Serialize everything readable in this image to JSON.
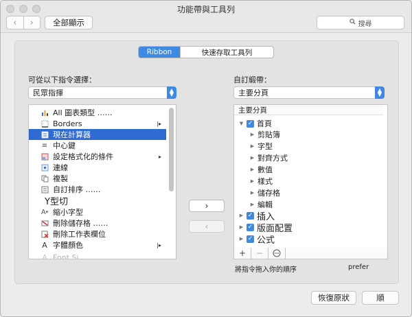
{
  "window": {
    "title": "功能帶與工具列"
  },
  "toolbar": {
    "back_icon": "chevron-left-icon",
    "forward_icon": "chevron-right-icon",
    "show_all": "全部顯示",
    "search_placeholder": "搜尋"
  },
  "tabs": [
    {
      "label": "Ribbon",
      "selected": true
    },
    {
      "label": "快速存取工具列",
      "selected": false
    }
  ],
  "left": {
    "label": "可從以下指令選擇：",
    "dropdown_value": "民眾指揮",
    "commands": [
      {
        "icon": "chart-icon",
        "label": "All 圖表類型 ……",
        "marker": ""
      },
      {
        "icon": "borders-icon",
        "label": "Borders",
        "marker": "|▸"
      },
      {
        "icon": "calculator-icon",
        "label": "現在計算器",
        "marker": "",
        "selected": true
      },
      {
        "icon": "center-icon",
        "label": "中心鍵",
        "marker": ""
      },
      {
        "icon": "conditional-format-icon",
        "label": "設定格式化的條件",
        "marker": "▸"
      },
      {
        "icon": "link-icon",
        "label": "連線",
        "marker": ""
      },
      {
        "icon": "copy-icon",
        "label": "複製",
        "marker": ""
      },
      {
        "icon": "sort-icon",
        "label": "自訂排序 ……",
        "marker": ""
      },
      {
        "icon": "",
        "label": "Y型切",
        "marker": ""
      },
      {
        "icon": "shrink-font-icon",
        "label": "縮小字型",
        "marker": ""
      },
      {
        "icon": "delete-cells-icon",
        "label": "刪除儲存格 ……",
        "marker": ""
      },
      {
        "icon": "delete-sheet-icon",
        "label": "刪除工作表欄位",
        "marker": ""
      },
      {
        "icon": "font-color-icon",
        "label": "字體顏色",
        "marker": "|▸"
      },
      {
        "icon": "font-size-icon",
        "label": "Font Si…",
        "marker": ""
      }
    ]
  },
  "right": {
    "label": "自訂緞帶：",
    "dropdown_value": "主要分頁",
    "tree_header": "主要分頁",
    "tree": [
      {
        "label": "首頁",
        "level": 0,
        "expanded": true,
        "checked": true
      },
      {
        "label": "剪貼簿",
        "level": 1
      },
      {
        "label": "字型",
        "level": 1
      },
      {
        "label": "對齊方式",
        "level": 1
      },
      {
        "label": "數值",
        "level": 1
      },
      {
        "label": "樣式",
        "level": 1
      },
      {
        "label": "儲存格",
        "level": 1
      },
      {
        "label": "編輯",
        "level": 1
      },
      {
        "label": "插入",
        "level": 0,
        "expanded": false,
        "checked": true
      },
      {
        "label": "版面配置",
        "level": 0,
        "expanded": false,
        "checked": true
      },
      {
        "label": "公式",
        "level": 0,
        "expanded": false,
        "checked": true
      }
    ],
    "add_icon": "plus-icon",
    "remove_icon": "minus-icon",
    "more_icon": "more-icon",
    "hint": "將指令拖入你的順序",
    "prefer": "prefer"
  },
  "buttons": {
    "add": "›",
    "remove": "‹",
    "restore": "恢復原狀",
    "ok": "順"
  }
}
